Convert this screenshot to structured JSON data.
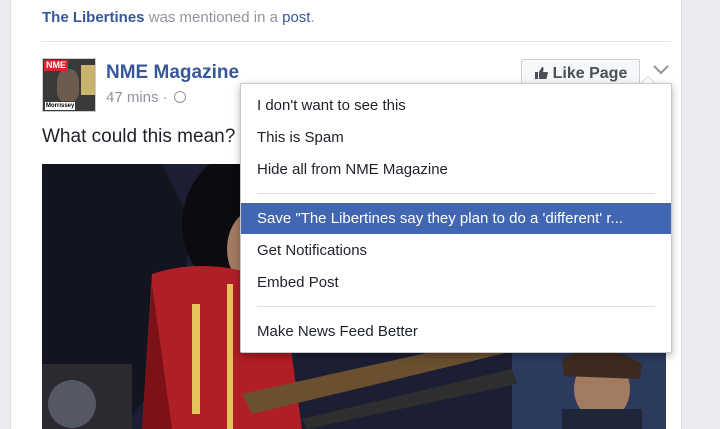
{
  "mention": {
    "subject": "The Libertines",
    "middle": " was mentioned in a ",
    "link": "post",
    "end": "."
  },
  "post": {
    "page_name": "NME Magazine",
    "time": "47 mins · ",
    "caption": "What could this mean?",
    "avatar": {
      "logo": "NME",
      "tag": "Morrissey"
    },
    "like_button": "Like Page"
  },
  "menu": {
    "items": [
      "I don't want to see this",
      "This is Spam",
      "Hide all from NME Magazine",
      "Save \"The Libertines say they plan to do a 'different' r...",
      "Get Notifications",
      "Embed Post",
      "Make News Feed Better"
    ]
  },
  "colors": {
    "link": "#365899",
    "highlight": "#4267b2",
    "muted": "#90949c"
  }
}
